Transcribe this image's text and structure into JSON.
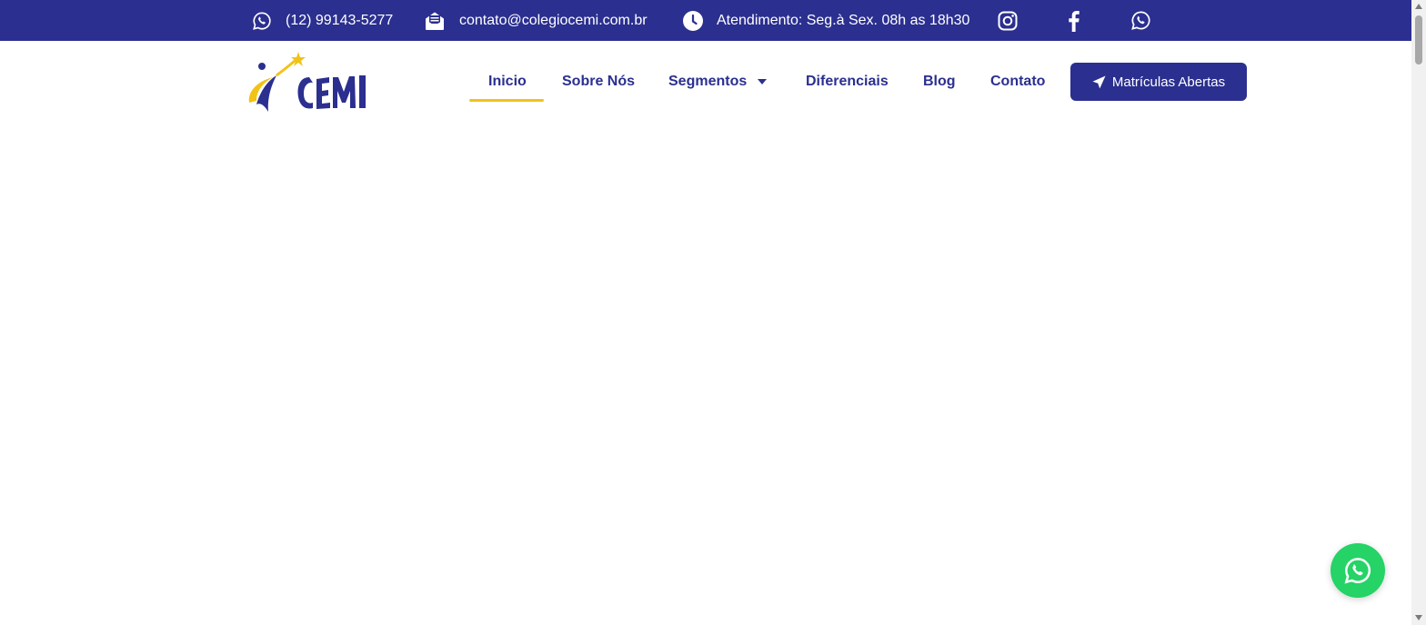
{
  "topbar": {
    "phone": "(12) 99143-5277",
    "email": "contato@colegiocemi.com.br",
    "hours": "Atendimento: Seg.à Sex. 08h as 18h30",
    "social": [
      "instagram-icon",
      "facebook-icon",
      "whatsapp-icon"
    ]
  },
  "logo": {
    "text": "CEMI"
  },
  "nav": {
    "items": [
      {
        "label": "Inicio",
        "active": true
      },
      {
        "label": "Sobre Nós"
      },
      {
        "label": "Segmentos",
        "has_dropdown": true
      },
      {
        "label": "Diferenciais"
      },
      {
        "label": "Blog"
      },
      {
        "label": "Contato"
      }
    ],
    "cta": "Matrículas Abertas"
  },
  "colors": {
    "primary": "#2b2f8f",
    "accent": "#f2c317",
    "whatsapp": "#25d366"
  }
}
